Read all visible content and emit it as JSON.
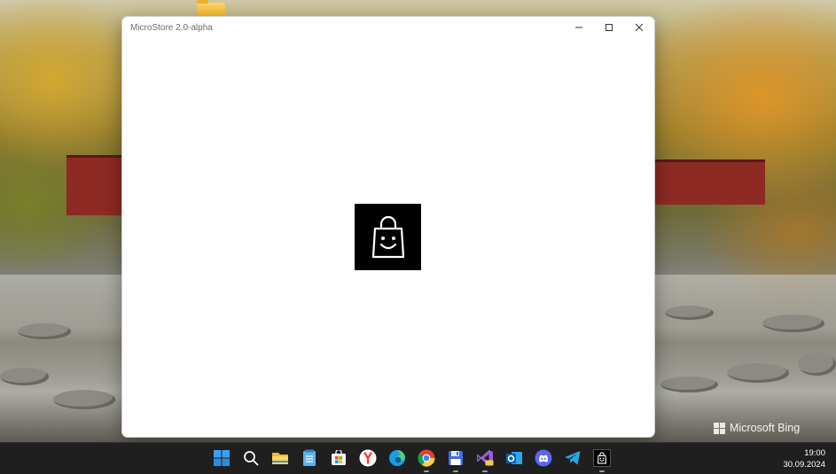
{
  "window": {
    "title": "MicroStore 2.0-alpha",
    "minimize_icon": "minimize-icon",
    "maximize_icon": "maximize-icon",
    "close_icon": "close-icon",
    "splash_icon": "shopping-bag-smile-icon"
  },
  "desktop": {
    "watermark": "Microsoft Bing",
    "folder_icon": "folder-icon"
  },
  "taskbar": {
    "items": [
      {
        "name": "start",
        "icon": "windows-start-icon"
      },
      {
        "name": "search",
        "icon": "search-icon"
      },
      {
        "name": "file-explorer",
        "icon": "folder-icon"
      },
      {
        "name": "notepad",
        "icon": "notepad-icon"
      },
      {
        "name": "microsoft-store",
        "icon": "store-icon"
      },
      {
        "name": "yandex-browser",
        "icon": "yandex-icon"
      },
      {
        "name": "edge",
        "icon": "edge-icon"
      },
      {
        "name": "chrome",
        "icon": "chrome-icon",
        "running": true
      },
      {
        "name": "save-app",
        "icon": "floppy-disk-icon",
        "running": true
      },
      {
        "name": "visual-studio-preview",
        "icon": "visual-studio-icon",
        "running": true
      },
      {
        "name": "outlook",
        "icon": "outlook-icon"
      },
      {
        "name": "discord",
        "icon": "discord-icon"
      },
      {
        "name": "telegram",
        "icon": "telegram-icon"
      },
      {
        "name": "microstore",
        "icon": "shopping-bag-smile-icon",
        "running": true
      }
    ],
    "clock": {
      "time": "19:00",
      "date": "30.09.2024"
    }
  },
  "colors": {
    "taskbar_bg": "#1f1f1f",
    "window_bg": "#ffffff",
    "splash_bg": "#000000"
  }
}
